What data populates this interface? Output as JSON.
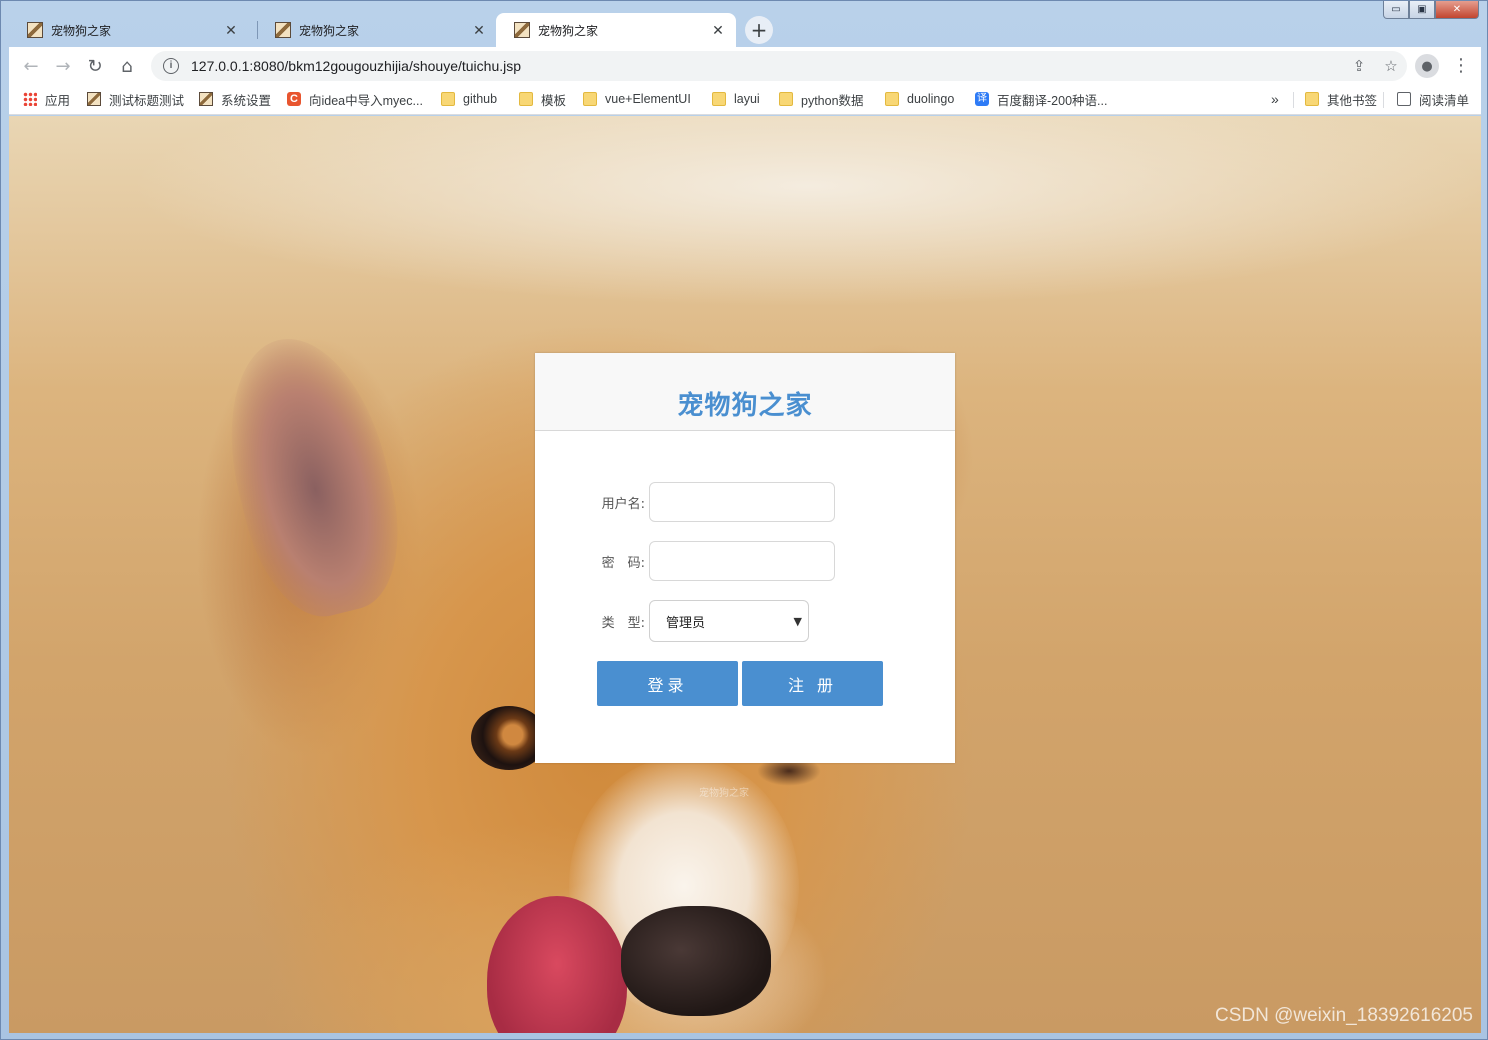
{
  "window": {
    "controls": {
      "minimize": "▭",
      "maximize": "▣",
      "close": "✕"
    }
  },
  "tabs": [
    {
      "title": "宠物狗之家",
      "active": false
    },
    {
      "title": "宠物狗之家",
      "active": false
    },
    {
      "title": "宠物狗之家",
      "active": true
    }
  ],
  "new_tab_label": "+",
  "toolbar": {
    "back_icon": "←",
    "forward_icon": "→",
    "reload_icon": "↻",
    "home_icon": "⌂",
    "url": "127.0.0.1:8080/bkm12gougouzhijia/shouye/tuichu.jsp",
    "info_icon": "i",
    "share_icon": "⇪",
    "star_icon": "☆",
    "profile_icon": "👤",
    "menu_icon": "⋮"
  },
  "bookmarks": {
    "items": [
      {
        "label": "应用",
        "icon": "apps-icon"
      },
      {
        "label": "测试标题测试",
        "icon": "image-icon"
      },
      {
        "label": "系统设置",
        "icon": "image-icon"
      },
      {
        "label": "向idea中导入myec...",
        "icon": "csdn-icon"
      },
      {
        "label": "github",
        "icon": "folder-icon"
      },
      {
        "label": "模板",
        "icon": "folder-icon"
      },
      {
        "label": "vue+ElementUI",
        "icon": "folder-icon"
      },
      {
        "label": "layui",
        "icon": "folder-icon"
      },
      {
        "label": "python数据",
        "icon": "folder-icon"
      },
      {
        "label": "duolingo",
        "icon": "folder-icon"
      },
      {
        "label": "百度翻译-200种语...",
        "icon": "translate-icon"
      }
    ],
    "overflow": "»",
    "other_bookmarks": "其他书签",
    "reading_list": "阅读清单",
    "csdn_glyph": "C",
    "translate_glyph": "译"
  },
  "login": {
    "title": "宠物狗之家",
    "username_label": "用户名:",
    "password_label": "密　码:",
    "type_label": "类　型:",
    "username_value": "",
    "password_value": "",
    "type_selected": "管理员",
    "login_button": "登录",
    "register_button": "注 册"
  },
  "footer_text": "宠物狗之家",
  "watermark": "CSDN @weixin_18392616205"
}
